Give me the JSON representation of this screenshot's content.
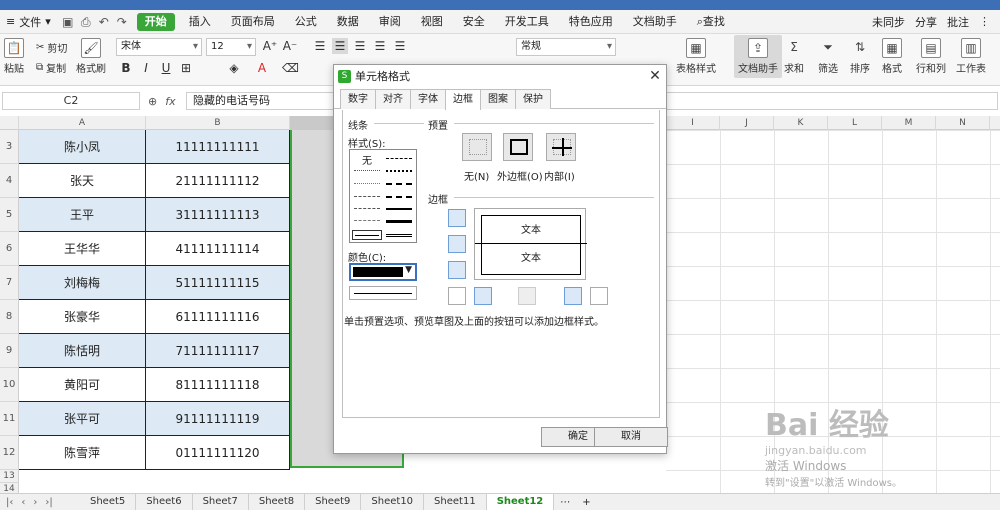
{
  "menubar": {
    "file": "文件",
    "tabs": [
      "开始",
      "插入",
      "页面布局",
      "公式",
      "数据",
      "审阅",
      "视图",
      "安全",
      "开发工具",
      "特色应用",
      "文档助手",
      "查找"
    ],
    "right": [
      "未同步",
      "分享",
      "批注"
    ]
  },
  "ribbon": {
    "paste": "粘贴",
    "cut": "剪切",
    "copy": "复制",
    "format_painter": "格式刷",
    "font": "宋体",
    "size": "12",
    "number_format": "常规",
    "table_style": "表格样式",
    "doc_assistant": "文档助手",
    "sum": "求和",
    "filter": "筛选",
    "sort": "排序",
    "format": "格式",
    "row_col": "行和列",
    "worksheet": "工作表"
  },
  "formula": {
    "cell_ref": "C2",
    "content": "隐藏的电话号码"
  },
  "columns": [
    "A",
    "B",
    "",
    "I",
    "J",
    "K",
    "L",
    "M",
    "N"
  ],
  "rows": [
    {
      "num": "3",
      "name": "陈小凤",
      "phone": "11111111111"
    },
    {
      "num": "4",
      "name": "张天",
      "phone": "21111111112"
    },
    {
      "num": "5",
      "name": "王平",
      "phone": "31111111113"
    },
    {
      "num": "6",
      "name": "王华华",
      "phone": "41111111114"
    },
    {
      "num": "7",
      "name": "刘梅梅",
      "phone": "51111111115"
    },
    {
      "num": "8",
      "name": "张豪华",
      "phone": "61111111116"
    },
    {
      "num": "9",
      "name": "陈恬明",
      "phone": "71111111117"
    },
    {
      "num": "10",
      "name": "黄阳可",
      "phone": "81111111118"
    },
    {
      "num": "11",
      "name": "张平可",
      "phone": "91111111119"
    },
    {
      "num": "12",
      "name": "陈雪萍",
      "phone": "01111111120"
    }
  ],
  "extra_rows": [
    "13",
    "14"
  ],
  "sheets": [
    "Sheet5",
    "Sheet6",
    "Sheet7",
    "Sheet8",
    "Sheet9",
    "Sheet10",
    "Sheet11",
    "Sheet12"
  ],
  "active_sheet_index": 7,
  "dialog": {
    "title": "单元格格式",
    "tabs": [
      "数字",
      "对齐",
      "字体",
      "边框",
      "图案",
      "保护"
    ],
    "active_tab": 3,
    "line_group": "线条",
    "style_label": "样式(S):",
    "style_none": "无",
    "color_label": "颜色(C):",
    "preset_group": "预置",
    "presets": [
      "无(N)",
      "外边框(O)",
      "内部(I)"
    ],
    "border_group": "边框",
    "preview_text": "文本",
    "hint": "单击预置选项、预览草图及上面的按钮可以添加边框样式。",
    "ok": "确定",
    "cancel": "取消"
  },
  "watermark": {
    "brand": "Bai 经验",
    "url": "jingyan.baidu.com",
    "activate": "激活 Windows",
    "activate_hint": "转到\"设置\"以激活 Windows。"
  },
  "colors": {
    "accent_green": "#3aa63a",
    "row_alt": "#dde9f4",
    "selected_col": "#d9d9d9"
  }
}
